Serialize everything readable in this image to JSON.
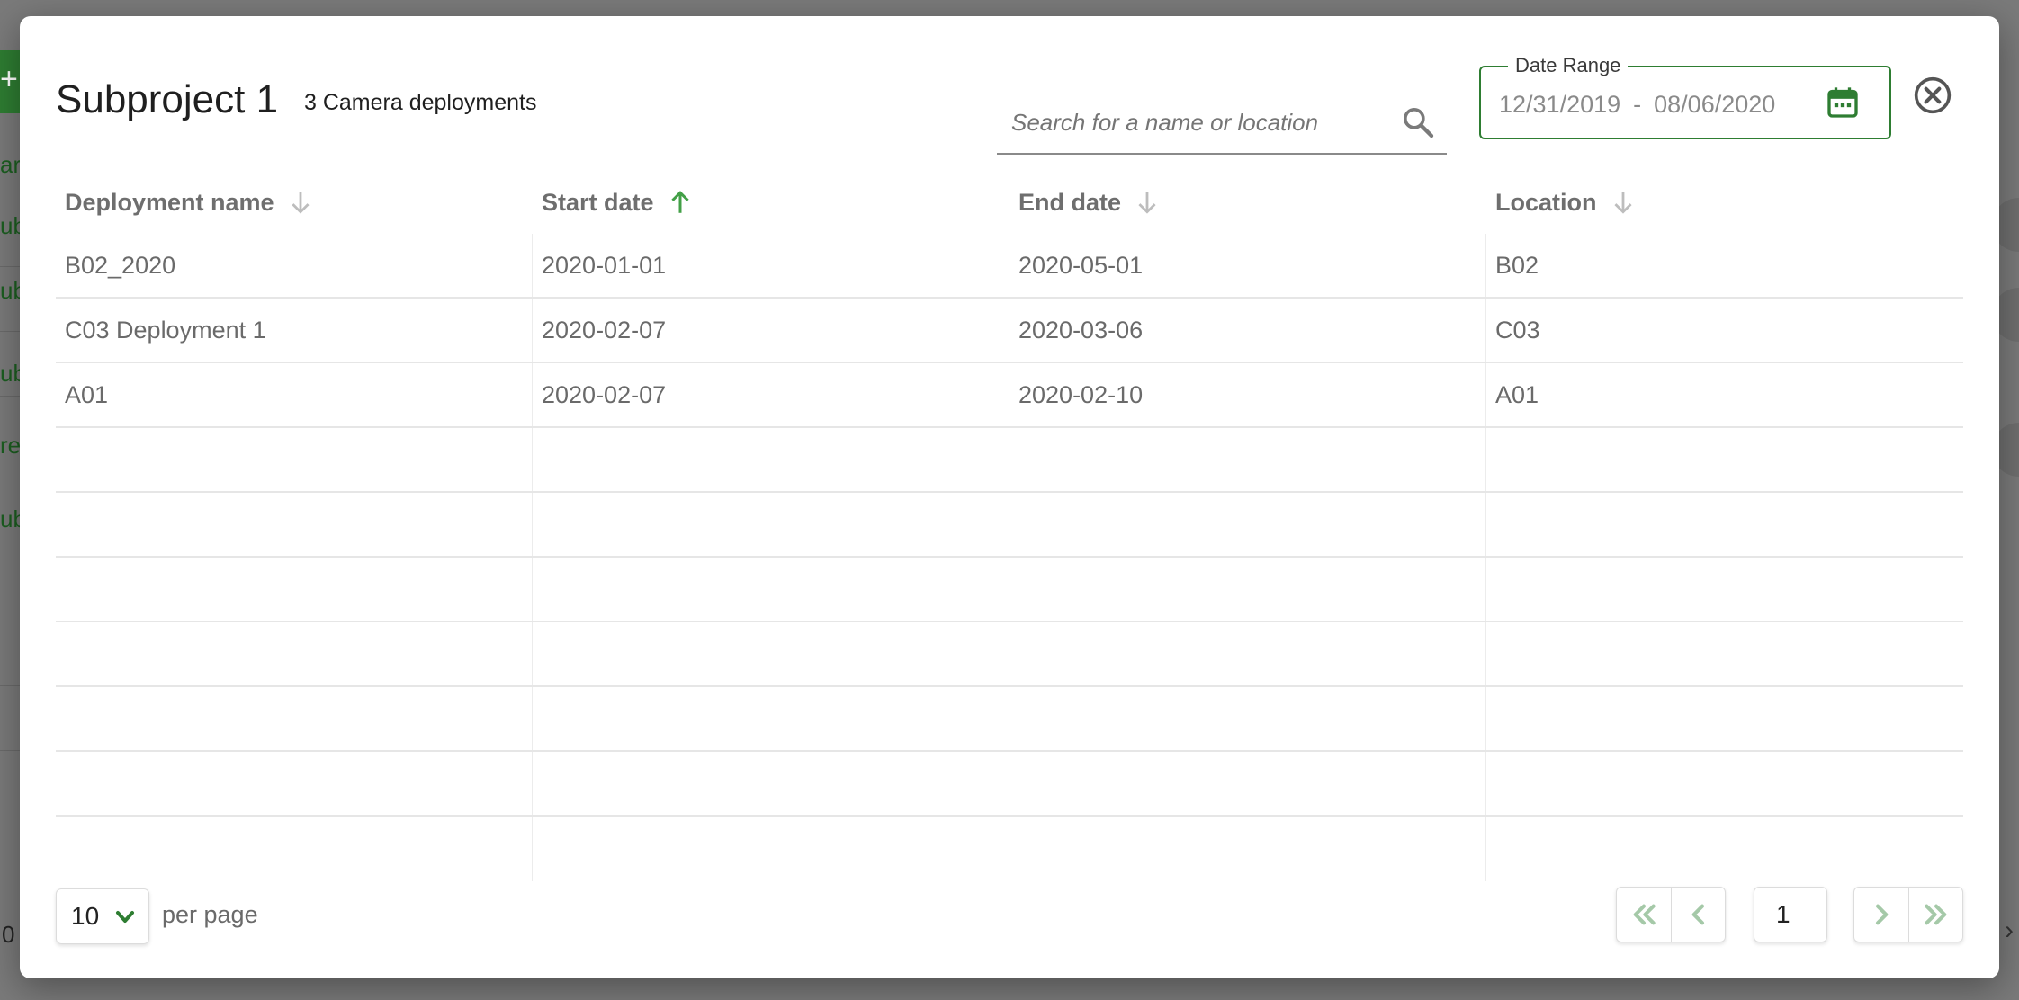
{
  "background": {
    "add_button_glyph": "+",
    "partial_texts": [
      "ar",
      "ub",
      "ub",
      "ub",
      "re",
      "ub"
    ],
    "pager_left_text": "0",
    "pager_right_glyph": "›"
  },
  "modal": {
    "title": "Subproject 1",
    "subtitle": "3 Camera deployments",
    "search": {
      "placeholder": "Search for a name or location",
      "value": "",
      "icon": "search-icon"
    },
    "date_range": {
      "label": "Date Range",
      "start": "12/31/2019",
      "separator": "-",
      "end": "08/06/2020",
      "icon": "calendar-icon"
    },
    "close_icon": "close-circle-icon",
    "accent_color": "#2e7d32",
    "table": {
      "columns": [
        {
          "label": "Deployment name",
          "sort": "desc",
          "active": false
        },
        {
          "label": "Start date",
          "sort": "asc",
          "active": true
        },
        {
          "label": "End date",
          "sort": "desc",
          "active": false
        },
        {
          "label": "Location",
          "sort": "desc",
          "active": false
        }
      ],
      "rows": [
        [
          "B02_2020",
          "2020-01-01",
          "2020-05-01",
          "B02"
        ],
        [
          "C03 Deployment 1",
          "2020-02-07",
          "2020-03-06",
          "C03"
        ],
        [
          "A01",
          "2020-02-07",
          "2020-02-10",
          "A01"
        ]
      ],
      "empty_rows": 7
    },
    "footer": {
      "per_page_value": "10",
      "per_page_label": "per page",
      "current_page": "1"
    }
  }
}
